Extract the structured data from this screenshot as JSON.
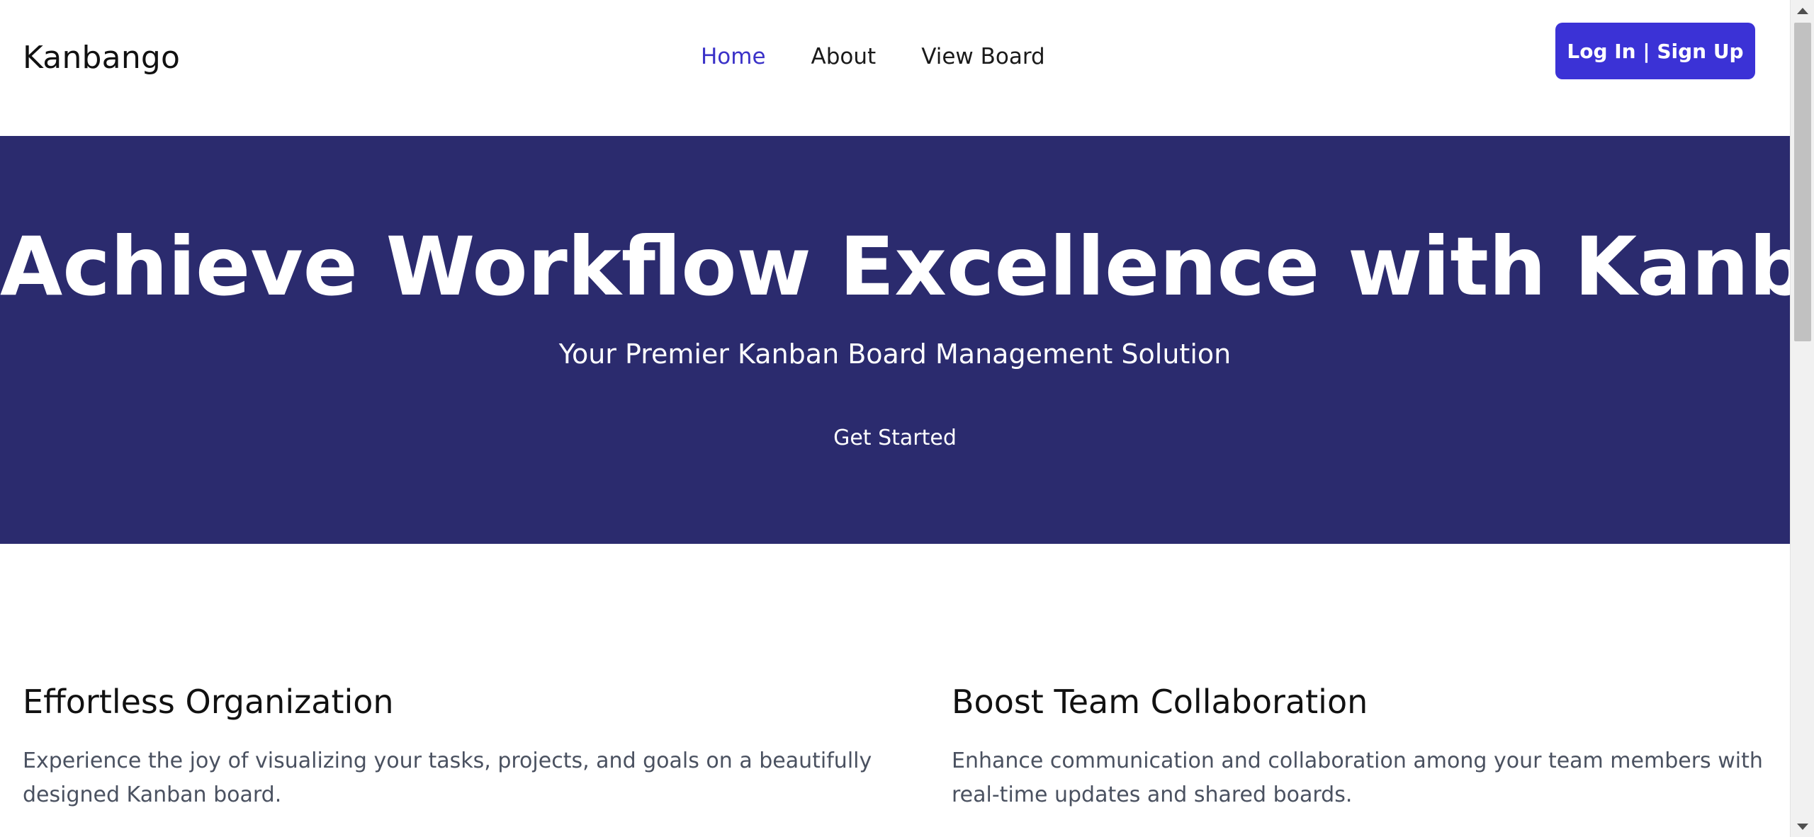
{
  "header": {
    "brand": "Kanbango",
    "nav": [
      {
        "label": "Home",
        "active": true
      },
      {
        "label": "About",
        "active": false
      },
      {
        "label": "View Board",
        "active": false
      }
    ],
    "auth_button_label": "Log In | Sign Up"
  },
  "hero": {
    "title": "Achieve Workflow Excellence with Kanbango",
    "subtitle": "Your Premier Kanban Board Management Solution",
    "cta_label": "Get Started"
  },
  "features": [
    {
      "title": "Effortless Organization",
      "text": "Experience the joy of visualizing your tasks, projects, and goals on a beautifully designed Kanban board."
    },
    {
      "title": "Boost Team Collaboration",
      "text": "Enhance communication and collaboration among your team members with real-time updates and shared boards."
    }
  ],
  "colors": {
    "accent": "#3b32d6",
    "nav_active": "#3b32c8",
    "hero_background": "#2b2b6e",
    "body_text_muted": "#4a5160"
  },
  "icons": {
    "scroll_up": "triangle-up-icon",
    "scroll_down": "triangle-down-icon"
  }
}
